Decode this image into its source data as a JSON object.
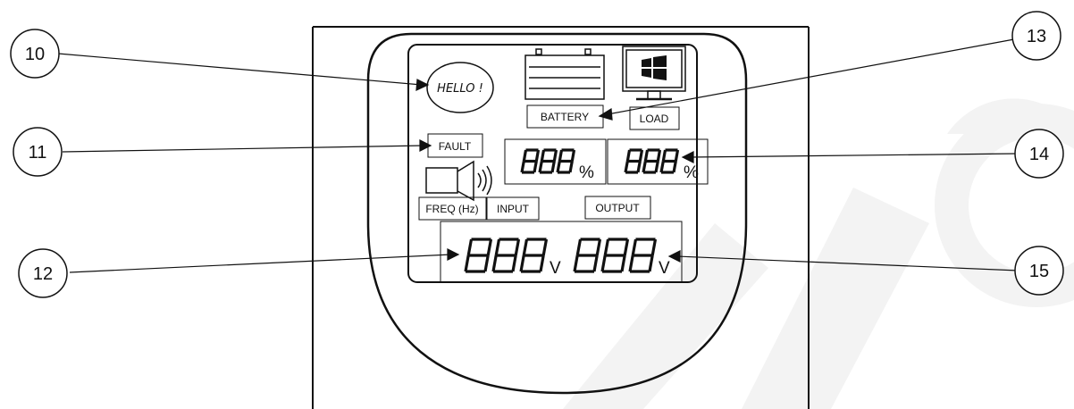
{
  "lcd": {
    "hello": "HELLO !",
    "battery": "BATTERY",
    "load": "LOAD",
    "fault": "FAULT",
    "freq": "FREQ (Hz)",
    "input": "INPUT",
    "output": "OUTPUT",
    "upper_left_value": "888",
    "upper_left_unit": "%",
    "upper_right_value": "888",
    "upper_right_unit": "%",
    "lower_left_value": "888",
    "lower_left_unit": "V",
    "lower_right_value": "888",
    "lower_right_unit": "V"
  },
  "callouts": [
    "10",
    "11",
    "12",
    "13",
    "14",
    "15"
  ],
  "colors": {
    "ink": "#111111",
    "watermark": "#f2f2f2",
    "background": "#ffffff"
  },
  "icons": [
    "battery-icon",
    "monitor-icon",
    "windows-logo-icon",
    "speaker-icon",
    "sound-waves-icon"
  ]
}
